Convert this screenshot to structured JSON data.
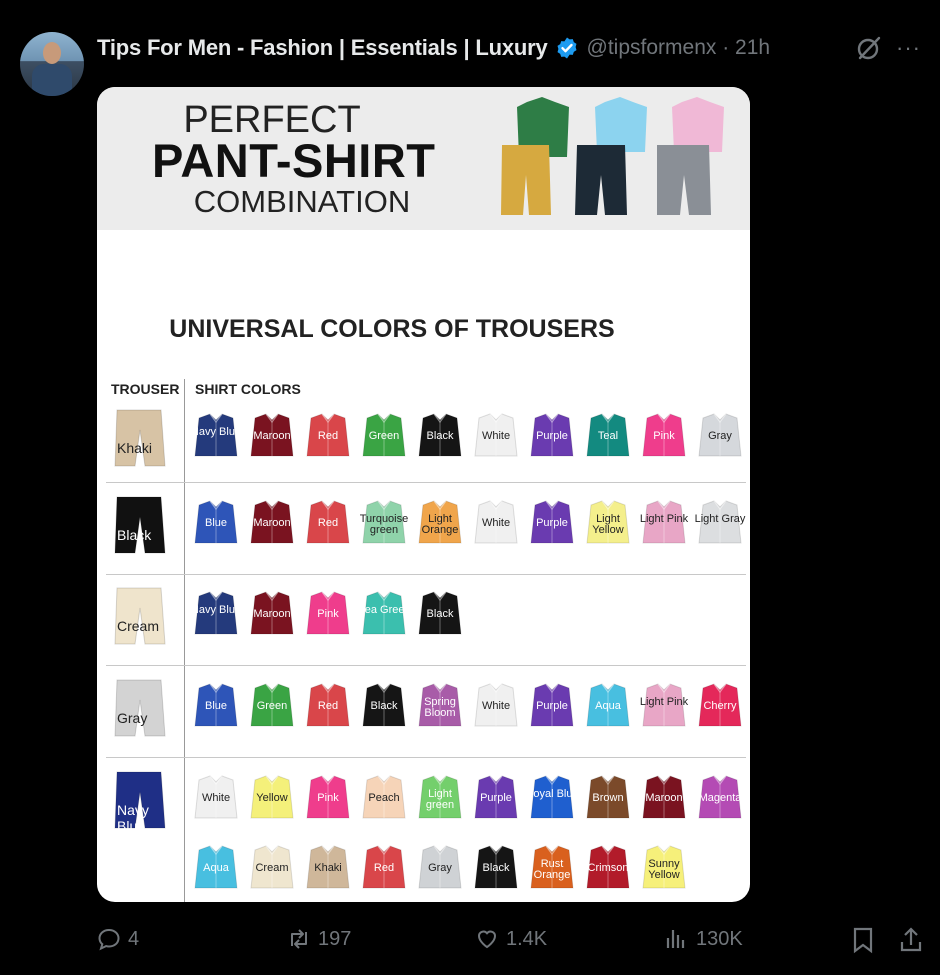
{
  "post": {
    "author_name": "Tips For Men - Fashion | Essentials | Luxury",
    "handle_time": "@tipsformenx · 21h",
    "more_label": "···"
  },
  "image": {
    "title_top": "PERFECT",
    "title_main": "PANT-SHIRT",
    "title_bottom": "COMBINATION",
    "heading": "UNIVERSAL COLORS OF TROUSERS",
    "col_trouser": "TROUSER",
    "col_shirts": "SHIRT COLORS",
    "rows": [
      {
        "trouser": "Khaki",
        "trouser_color": "#d7c3a5",
        "shirts": [
          {
            "label": "Navy Blue",
            "color": "#243a7c"
          },
          {
            "label": "Maroon",
            "color": "#7a1320"
          },
          {
            "label": "Red",
            "color": "#d9464a"
          },
          {
            "label": "Green",
            "color": "#3aa444"
          },
          {
            "label": "Black",
            "color": "#151515"
          },
          {
            "label": "White",
            "color": "#f0f0f0"
          },
          {
            "label": "Purple",
            "color": "#6a3bb0"
          },
          {
            "label": "Teal",
            "color": "#138a80"
          },
          {
            "label": "Pink",
            "color": "#ef3d8c"
          },
          {
            "label": "Gray",
            "color": "#d5d8dc"
          }
        ]
      },
      {
        "trouser": "Black",
        "trouser_color": "#111111",
        "shirts": [
          {
            "label": "Blue",
            "color": "#2e55b8"
          },
          {
            "label": "Maroon",
            "color": "#7a1320"
          },
          {
            "label": "Red",
            "color": "#d9464a"
          },
          {
            "label": "Turquoise green",
            "color": "#8fd3aa"
          },
          {
            "label": "Light Orange",
            "color": "#f0a54b"
          },
          {
            "label": "White",
            "color": "#f0f0f0"
          },
          {
            "label": "Purple",
            "color": "#6a3bb0"
          },
          {
            "label": "Light Yellow",
            "color": "#f4ef8c"
          },
          {
            "label": "Light Pink",
            "color": "#e8a6c6"
          },
          {
            "label": "Light Gray",
            "color": "#dcdee0"
          }
        ]
      },
      {
        "trouser": "Cream",
        "trouser_color": "#efe4cc",
        "shirts": [
          {
            "label": "Navy Blue",
            "color": "#243a7c"
          },
          {
            "label": "Maroon",
            "color": "#7a1320"
          },
          {
            "label": "Pink",
            "color": "#ef3d8c"
          },
          {
            "label": "Sea Green",
            "color": "#3bbfae"
          },
          {
            "label": "Black",
            "color": "#151515"
          }
        ]
      },
      {
        "trouser": "Gray",
        "trouser_color": "#d3d3d3",
        "shirts": [
          {
            "label": "Blue",
            "color": "#2e55b8"
          },
          {
            "label": "Green",
            "color": "#3aa444"
          },
          {
            "label": "Red",
            "color": "#d9464a"
          },
          {
            "label": "Black",
            "color": "#151515"
          },
          {
            "label": "Spring Bloom",
            "color": "#a85ca8"
          },
          {
            "label": "White",
            "color": "#f0f0f0"
          },
          {
            "label": "Purple",
            "color": "#6a3bb0"
          },
          {
            "label": "Aqua",
            "color": "#48bfe0"
          },
          {
            "label": "Light Pink",
            "color": "#e8a6c6"
          },
          {
            "label": "Cherry",
            "color": "#e4285a"
          }
        ]
      },
      {
        "trouser": "Navy Blue",
        "trouser_color": "#1f2f86",
        "shirts": [
          {
            "label": "White",
            "color": "#f0f0f0"
          },
          {
            "label": "Yellow",
            "color": "#f4f07a"
          },
          {
            "label": "Pink",
            "color": "#ef3d8c"
          },
          {
            "label": "Peach",
            "color": "#f6d4b8"
          },
          {
            "label": "Light green",
            "color": "#74cf6c"
          },
          {
            "label": "Purple",
            "color": "#6a3bb0"
          },
          {
            "label": "Royal Blue",
            "color": "#1f5fcf"
          },
          {
            "label": "Brown",
            "color": "#7b4a2a"
          },
          {
            "label": "Maroon",
            "color": "#7a1320"
          },
          {
            "label": "Magenta",
            "color": "#b44bb4"
          },
          {
            "label": "Aqua",
            "color": "#48bfe0"
          },
          {
            "label": "Cream",
            "color": "#efe6cf"
          },
          {
            "label": "Khaki",
            "color": "#cfb79a"
          },
          {
            "label": "Red",
            "color": "#d9464a"
          },
          {
            "label": "Gray",
            "color": "#cfd2d5"
          },
          {
            "label": "Black",
            "color": "#151515"
          },
          {
            "label": "Rust Orange",
            "color": "#d9601e"
          },
          {
            "label": "Crimson",
            "color": "#b21b2a"
          },
          {
            "label": "Sunny Yellow",
            "color": "#f6f07a"
          }
        ]
      }
    ]
  },
  "metrics": {
    "replies": "4",
    "reposts": "197",
    "likes": "1.4K",
    "views": "130K"
  },
  "colors": {
    "verified": "#1d9bf0",
    "muted": "#71767b"
  }
}
